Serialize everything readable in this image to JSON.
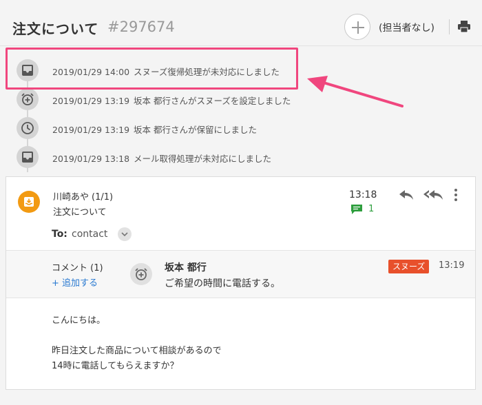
{
  "header": {
    "title": "注文について",
    "ticket_id": "#297674",
    "assignee": "(担当者なし)"
  },
  "timeline": [
    {
      "icon": "inbox-icon",
      "timestamp": "2019/01/29 14:00",
      "text": "スヌーズ復帰処理が未対応にしました"
    },
    {
      "icon": "alarm-plus-icon",
      "timestamp": "2019/01/29 13:19",
      "text": "坂本 都行さんがスヌーズを設定しました"
    },
    {
      "icon": "clock-icon",
      "timestamp": "2019/01/29 13:19",
      "text": "坂本 都行さんが保留にしました"
    },
    {
      "icon": "inbox-icon",
      "timestamp": "2019/01/29 13:18",
      "text": "メール取得処理が未対応にしました"
    }
  ],
  "message": {
    "sender": "川崎あや",
    "sender_count": "(1/1)",
    "subject": "注文について",
    "to_label": "To:",
    "to_value": "contact",
    "time": "13:18",
    "comment_count": "1",
    "comment": {
      "label": "コメント (1)",
      "add_label": "+ 追加する",
      "author": "坂本 都行",
      "text": "ご希望の時間に電話する。",
      "badge": "スヌーズ",
      "time": "13:19"
    },
    "body": {
      "line1": "こんにちは。",
      "line2": "昨日注文した商品について相談があるので",
      "line3": "14時に電話してもらえますか？"
    }
  },
  "colors": {
    "highlight": "#f0467e",
    "avatar": "#f29a12",
    "snooze": "#e8502b",
    "link": "#2a7ad1",
    "comment_green": "#2e9e3e"
  }
}
